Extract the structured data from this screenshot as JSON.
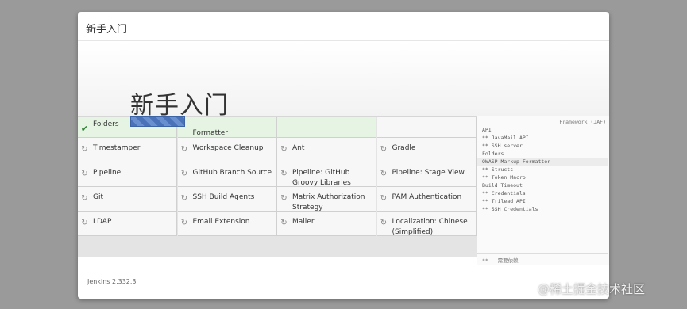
{
  "header": {
    "title": "新手入门"
  },
  "hero": {
    "title": "新手入门"
  },
  "plugins": [
    [
      {
        "name": "Folders",
        "status": "done"
      },
      {
        "name": "Formatter",
        "status": "done"
      },
      {
        "name": "",
        "status": "done"
      },
      {
        "name": "",
        "status": "pending"
      }
    ],
    [
      {
        "name": "Timestamper",
        "status": "pending"
      },
      {
        "name": "Workspace Cleanup",
        "status": "pending"
      },
      {
        "name": "Ant",
        "status": "pending"
      },
      {
        "name": "Gradle",
        "status": "pending"
      }
    ],
    [
      {
        "name": "Pipeline",
        "status": "pending"
      },
      {
        "name": "GitHub Branch Source",
        "status": "pending"
      },
      {
        "name": "Pipeline: GitHub Groovy Libraries",
        "status": "pending"
      },
      {
        "name": "Pipeline: Stage View",
        "status": "pending"
      }
    ],
    [
      {
        "name": "Git",
        "status": "pending"
      },
      {
        "name": "SSH Build Agents",
        "status": "pending"
      },
      {
        "name": "Matrix Authorization Strategy",
        "status": "pending"
      },
      {
        "name": "PAM Authentication",
        "status": "pending"
      }
    ],
    [
      {
        "name": "LDAP",
        "status": "pending"
      },
      {
        "name": "Email Extension",
        "status": "pending"
      },
      {
        "name": "Mailer",
        "status": "pending"
      },
      {
        "name": "Localization: Chinese (Simplified)",
        "status": "pending"
      }
    ]
  ],
  "log": {
    "top": "Framework (JAF)",
    "lines": [
      {
        "text": "API",
        "hl": false
      },
      {
        "text": "** JavaMail API",
        "hl": false
      },
      {
        "text": "** SSH server",
        "hl": false
      },
      {
        "text": "Folders",
        "hl": false
      },
      {
        "text": "OWASP Markup Formatter",
        "hl": true
      },
      {
        "text": "** Structs",
        "hl": false
      },
      {
        "text": "** Token Macro",
        "hl": false
      },
      {
        "text": "Build Timeout",
        "hl": false
      },
      {
        "text": "** Credentials",
        "hl": false
      },
      {
        "text": "** Trilead API",
        "hl": false
      },
      {
        "text": "** SSH Credentials",
        "hl": false
      }
    ],
    "bottom": "** - 需要依赖"
  },
  "footer": {
    "version": "Jenkins 2.332.3"
  },
  "watermark": "@稀土掘金技术社区",
  "colors": {
    "done_bg": "#e6f4e3",
    "progress": "#4a72b8",
    "check": "#2e7d32"
  },
  "icons": {
    "done": "check-icon",
    "pending": "refresh-icon"
  }
}
